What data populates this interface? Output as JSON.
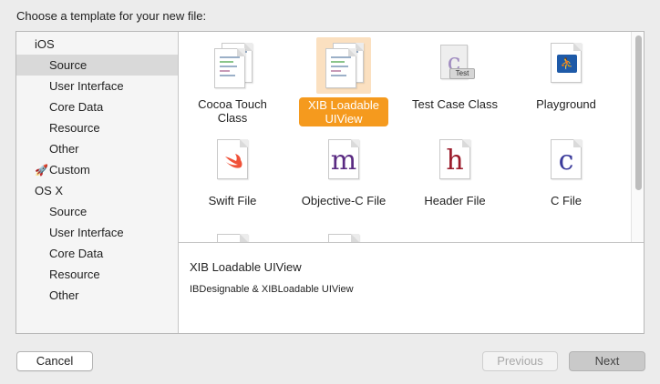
{
  "header": {
    "title": "Choose a template for your new file:"
  },
  "sidebar": {
    "sections": [
      {
        "label": "iOS",
        "items": [
          {
            "label": "Source"
          },
          {
            "label": "User Interface"
          },
          {
            "label": "Core Data"
          },
          {
            "label": "Resource"
          },
          {
            "label": "Other"
          },
          {
            "label": "Custom",
            "icon": "rocket-icon"
          }
        ]
      },
      {
        "label": "OS X",
        "items": [
          {
            "label": "Source"
          },
          {
            "label": "User Interface"
          },
          {
            "label": "Core Data"
          },
          {
            "label": "Resource"
          },
          {
            "label": "Other"
          }
        ]
      }
    ],
    "selected": "iOS / Source"
  },
  "templates": [
    {
      "label": "Cocoa Touch Class",
      "icon": "cocoa-touch-class-icon"
    },
    {
      "label": "XIB Loadable UIView",
      "icon": "xib-loadable-icon",
      "selected": true
    },
    {
      "label": "Test Case Class",
      "icon": "test-case-icon",
      "badge": "Test",
      "glyph": "c"
    },
    {
      "label": "Playground",
      "icon": "playground-icon"
    },
    {
      "label": "Swift File",
      "icon": "swift-icon"
    },
    {
      "label": "Objective-C File",
      "icon": "objc-file-icon",
      "glyph": "m"
    },
    {
      "label": "Header File",
      "icon": "header-file-icon",
      "glyph": "h"
    },
    {
      "label": "C File",
      "icon": "c-file-icon",
      "glyph": "c"
    }
  ],
  "colors": {
    "selection_accent": "#f59a1e",
    "selection_bg": "#fbe0c0",
    "objc_glyph": "#5a2a82",
    "header_glyph": "#9b1b2b",
    "c_glyph": "#3b3b9b",
    "swift_orange": "#f05138",
    "playground_blue": "#1e5aa8"
  },
  "description": {
    "title": "XIB Loadable UIView",
    "text": "IBDesignable & XIBLoadable UIView"
  },
  "buttons": {
    "cancel": "Cancel",
    "previous": "Previous",
    "next": "Next"
  }
}
